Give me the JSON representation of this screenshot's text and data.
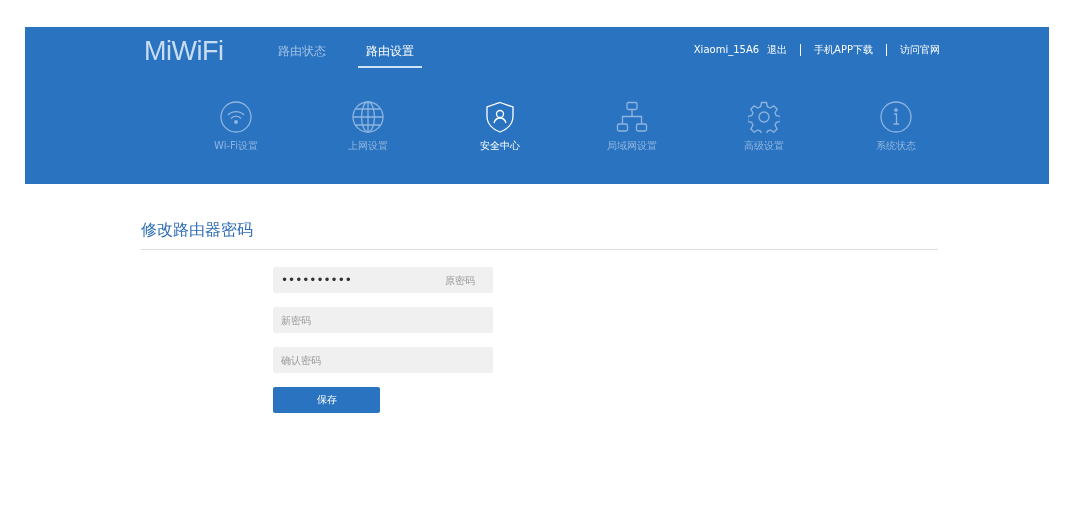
{
  "header": {
    "logo": "MiWiFi",
    "tabs": [
      {
        "label": "路由状态",
        "selected": false
      },
      {
        "label": "路由设置",
        "selected": true
      }
    ],
    "user": "Xiaomi_15A6",
    "links": [
      "退出",
      "手机APP下载",
      "访问官网"
    ],
    "nav": [
      {
        "kind": "wifi",
        "label": "Wi-Fi设置",
        "selected": false
      },
      {
        "kind": "globe",
        "label": "上网设置",
        "selected": false
      },
      {
        "kind": "shield",
        "label": "安全中心",
        "selected": true
      },
      {
        "kind": "network",
        "label": "局域网设置",
        "selected": false
      },
      {
        "kind": "gear",
        "label": "高级设置",
        "selected": false
      },
      {
        "kind": "info",
        "label": "系统状态",
        "selected": false
      }
    ]
  },
  "section": {
    "title": "修改路由器密码",
    "fields": [
      {
        "value": "••••••••••",
        "label": "原密码"
      },
      {
        "placeholder": "新密码"
      },
      {
        "placeholder": "确认密码"
      }
    ],
    "button": "保存"
  }
}
